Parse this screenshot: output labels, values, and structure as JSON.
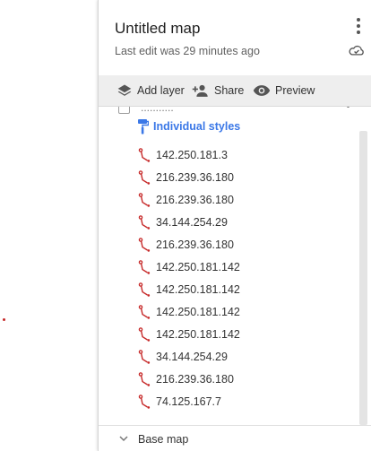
{
  "header": {
    "title": "Untitled map",
    "last_edit": "Last edit was 29 minutes ago",
    "more_icon": "more-vert-icon",
    "cloud_icon": "cloud-saved-icon"
  },
  "toolbar": {
    "add_layer_label": "Add layer",
    "add_layer_icon": "layers-icon",
    "share_label": "Share",
    "share_icon": "person-add-icon",
    "preview_label": "Preview",
    "preview_icon": "eye-icon"
  },
  "layer": {
    "clipped_name": "...........",
    "styles_label": "Individual styles",
    "styles_icon": "paint-roller-icon",
    "feature_icon": "path-line-icon",
    "features": [
      {
        "label": "142.250.181.3"
      },
      {
        "label": "216.239.36.180"
      },
      {
        "label": "216.239.36.180"
      },
      {
        "label": "34.144.254.29"
      },
      {
        "label": "216.239.36.180"
      },
      {
        "label": "142.250.181.142"
      },
      {
        "label": "142.250.181.142"
      },
      {
        "label": "142.250.181.142"
      },
      {
        "label": "142.250.181.142"
      },
      {
        "label": "34.144.254.29"
      },
      {
        "label": "216.239.36.180"
      },
      {
        "label": "74.125.167.7"
      }
    ]
  },
  "base_map": {
    "label": "Base map",
    "chevron_icon": "chevron-down-icon"
  },
  "colors": {
    "accent": "#3b78e7",
    "feature_icon": "#c62828",
    "toolbar_bg": "#eeeeee"
  }
}
